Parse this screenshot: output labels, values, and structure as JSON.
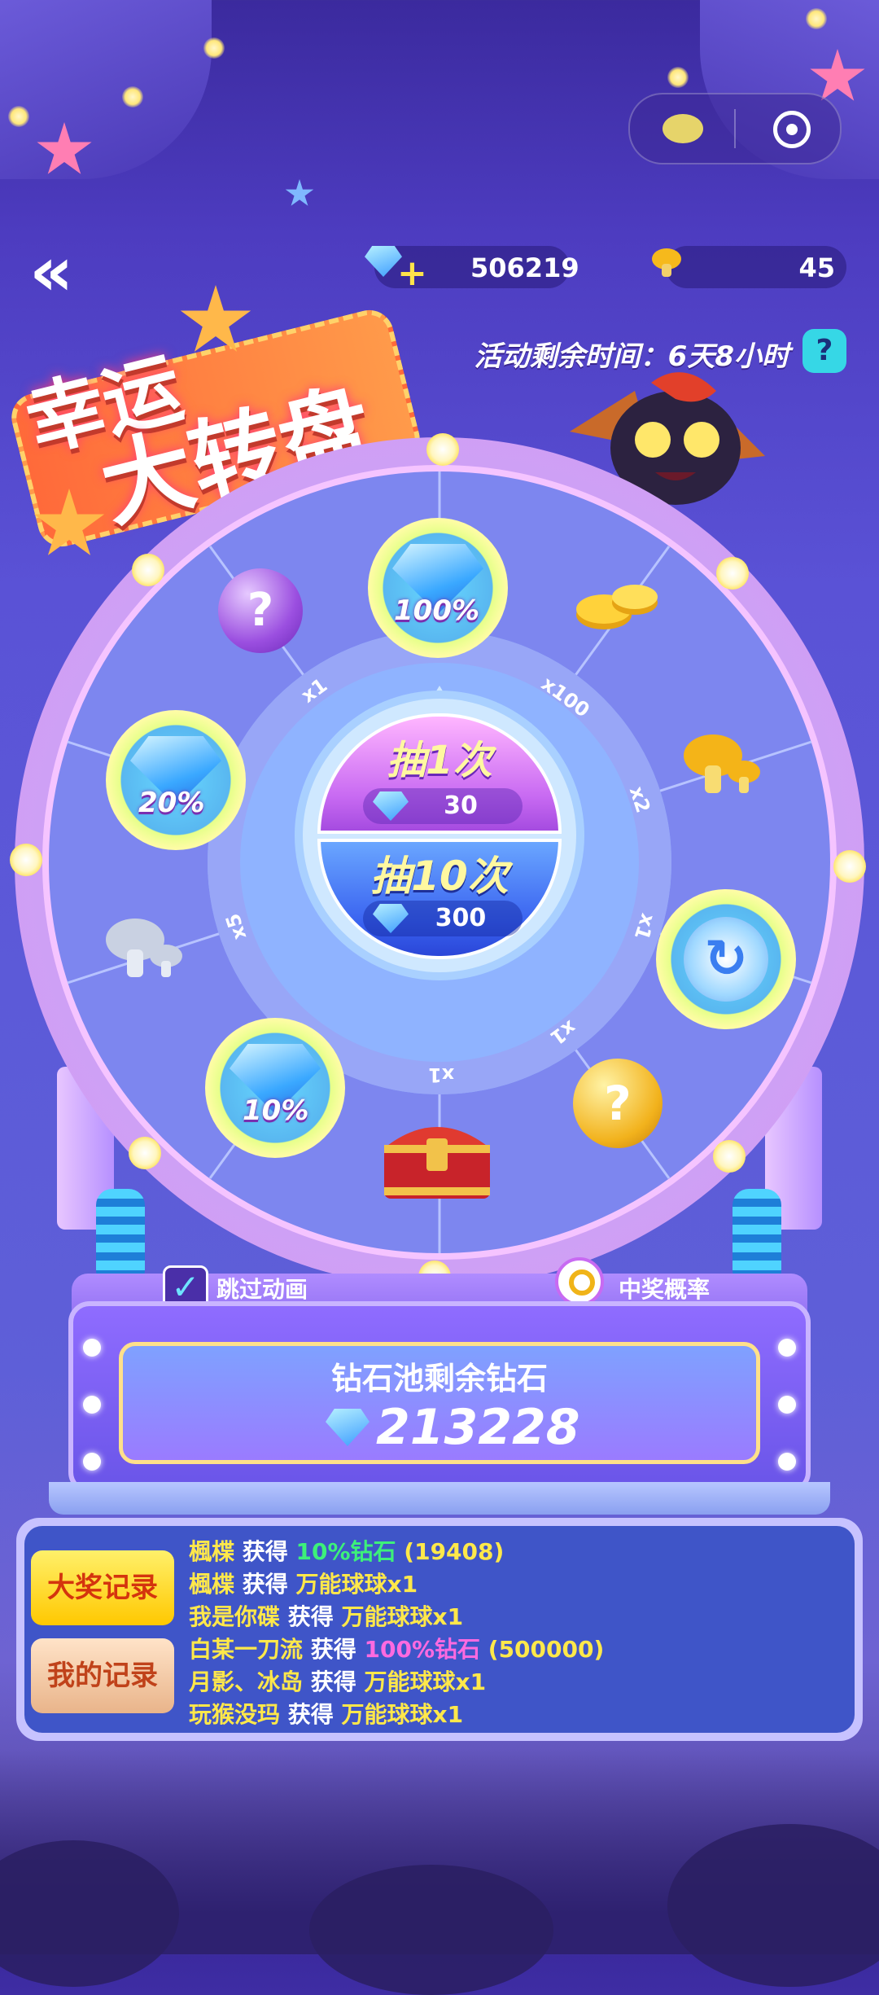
{
  "header": {
    "diamonds": "506219",
    "mushrooms": "45",
    "timer_label": "活动剩余时间：",
    "timer_value": "6天8小时",
    "help": "?"
  },
  "title": {
    "line1": "幸运",
    "line2": "大转盘"
  },
  "wheel": {
    "prizes": [
      {
        "name": "mystery-orb",
        "icon": "question-orb",
        "label": "?"
      },
      {
        "name": "gems-100",
        "label": "100%"
      },
      {
        "name": "gold-coins",
        "icon": "coins"
      },
      {
        "name": "gold-mushrooms",
        "icon": "mushroom"
      },
      {
        "name": "swap-ball",
        "icon": "refresh-ball"
      },
      {
        "name": "gold-mystery",
        "icon": "question-orb",
        "label": "?"
      },
      {
        "name": "treasure-chest",
        "icon": "chest"
      },
      {
        "name": "gems-10",
        "label": "10%"
      },
      {
        "name": "silver-mushrooms",
        "icon": "mushroom"
      },
      {
        "name": "gems-20",
        "label": "20%"
      }
    ],
    "multipliers": {
      "m1": "x1",
      "m2": "x100",
      "m3": "x2",
      "m4": "x1",
      "m5": "x1",
      "m6": "x1",
      "m7": "x5"
    }
  },
  "spin": {
    "once_label": "抽1次",
    "once_cost": "30",
    "ten_label": "抽10次",
    "ten_cost": "300"
  },
  "options": {
    "skip_animation": "跳过动画",
    "odds": "中奖概率"
  },
  "pool": {
    "title": "钻石池剩余钻石",
    "value": "213228"
  },
  "records": {
    "tab_big": "大奖记录",
    "tab_mine": "我的记录",
    "rows": [
      {
        "user": "楓楪",
        "verb": " 获得 ",
        "item": "10%钻石",
        "extra": " (19408)",
        "color": "grn"
      },
      {
        "user": "楓楪",
        "verb": " 获得 ",
        "item": "万能球球x1",
        "extra": "",
        "color": "yel"
      },
      {
        "user": "我是你碟",
        "verb": " 获得 ",
        "item": "万能球球x1",
        "extra": "",
        "color": "yel"
      },
      {
        "user": "白某一刀流",
        "verb": " 获得 ",
        "item": "100%钻石",
        "extra": " (500000)",
        "color": "pnk"
      },
      {
        "user": "月影、冰岛",
        "verb": " 获得 ",
        "item": "万能球球x1",
        "extra": "",
        "color": "yel"
      },
      {
        "user": "玩猴没玛",
        "verb": " 获得 ",
        "item": "万能球球x1",
        "extra": "",
        "color": "yel"
      }
    ]
  },
  "colors": {
    "accent_yellow": "#ffe84a",
    "accent_green": "#3df07a",
    "accent_pink": "#ff6ae0"
  }
}
